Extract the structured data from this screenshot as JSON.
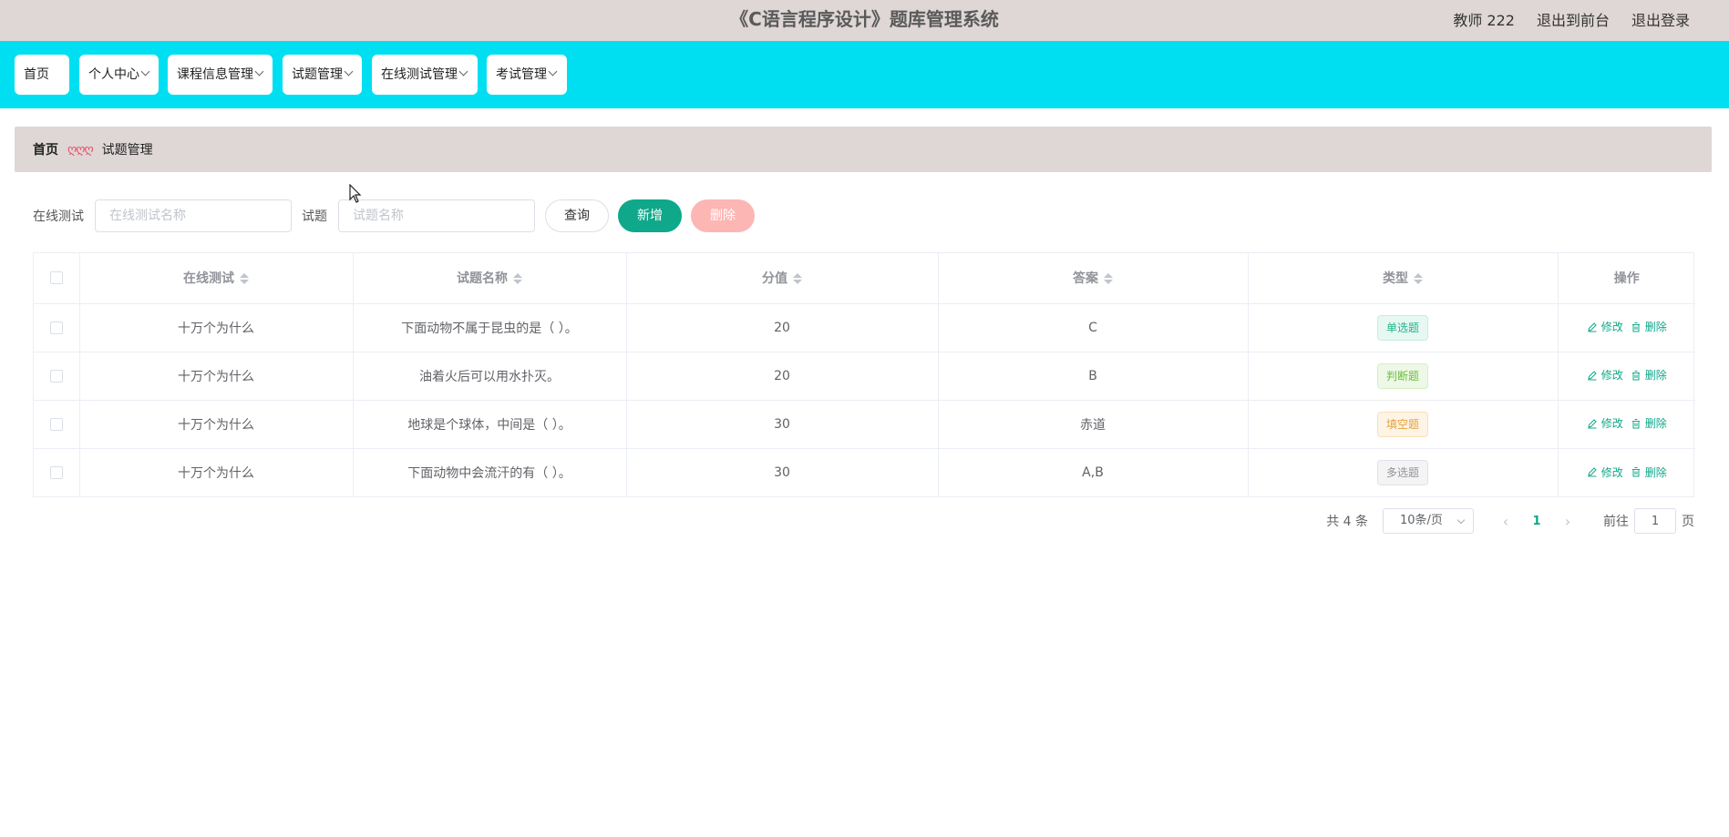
{
  "app": {
    "title": "《C语言程序设计》题库管理系统"
  },
  "header": {
    "user": "教师 222",
    "to_front": "退出到前台",
    "logout": "退出登录"
  },
  "nav": {
    "items": [
      {
        "label": "首页",
        "dropdown": false
      },
      {
        "label": "个人中心",
        "dropdown": true
      },
      {
        "label": "课程信息管理",
        "dropdown": true
      },
      {
        "label": "试题管理",
        "dropdown": true
      },
      {
        "label": "在线测试管理",
        "dropdown": true
      },
      {
        "label": "考试管理",
        "dropdown": true
      }
    ]
  },
  "breadcrumb": {
    "home": "首页",
    "separator": "ღღღ",
    "current": "试题管理"
  },
  "filters": {
    "test_label": "在线测试",
    "test_placeholder": "在线测试名称",
    "question_label": "试题",
    "question_placeholder": "试题名称"
  },
  "buttons": {
    "query": "查询",
    "add": "新增",
    "delete": "删除"
  },
  "table": {
    "headers": {
      "test": "在线测试",
      "question": "试题名称",
      "score": "分值",
      "answer": "答案",
      "type": "类型",
      "ops": "操作"
    },
    "rows": [
      {
        "test": "十万个为什么",
        "question": "下面动物不属于昆虫的是（ ）。",
        "score": "20",
        "answer": "C",
        "type": "单选题",
        "type_style": "green"
      },
      {
        "test": "十万个为什么",
        "question": "油着火后可以用水扑灭。",
        "score": "20",
        "answer": "B",
        "type": "判断题",
        "type_style": "lime"
      },
      {
        "test": "十万个为什么",
        "question": "地球是个球体，中间是（ ）。",
        "score": "30",
        "answer": "赤道",
        "type": "填空题",
        "type_style": "orange"
      },
      {
        "test": "十万个为什么",
        "question": "下面动物中会流汗的有（ ）。",
        "score": "30",
        "answer": "A,B",
        "type": "多选题",
        "type_style": "gray"
      }
    ],
    "edit_label": "修改",
    "delete_label": "删除"
  },
  "pagination": {
    "total": "共 4 条",
    "page_size": "10条/页",
    "current_page": "1",
    "goto_prefix": "前往",
    "goto_value": "1",
    "goto_suffix": "页"
  },
  "colors": {
    "topbar": "#dfd6d6",
    "navbar": "#00dff2",
    "accent": "#0fa88a",
    "delete_btn": "#fcb6b4"
  }
}
